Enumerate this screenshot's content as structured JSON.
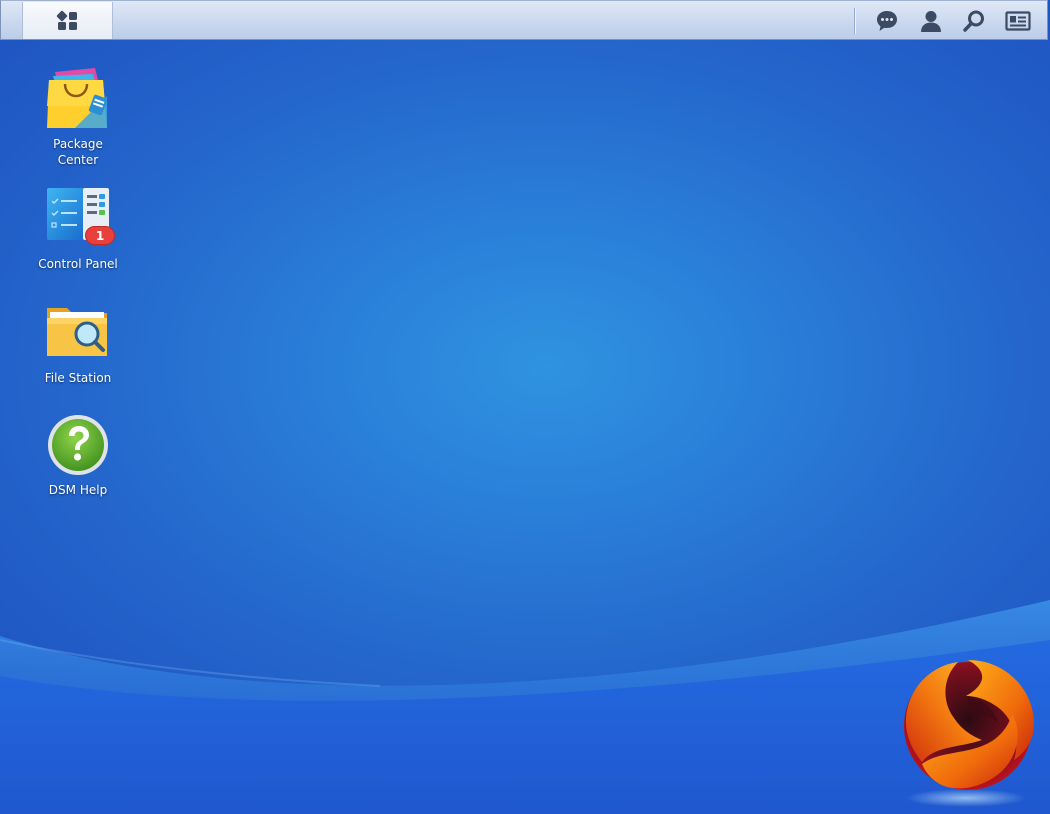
{
  "taskbar": {
    "main_menu_icon": "main-menu-grid-icon",
    "tray": [
      {
        "name": "notifications",
        "icon": "chat-bubble-icon"
      },
      {
        "name": "user-options",
        "icon": "user-icon"
      },
      {
        "name": "search",
        "icon": "search-icon"
      },
      {
        "name": "widgets",
        "icon": "id-card-icon"
      }
    ]
  },
  "desktop": {
    "shortcuts": [
      {
        "label": "Package\nCenter",
        "icon": "package-center-icon"
      },
      {
        "label": "Control Panel",
        "icon": "control-panel-icon",
        "badge": "1"
      },
      {
        "label": "File Station",
        "icon": "file-station-icon"
      },
      {
        "label": "DSM Help",
        "icon": "help-icon"
      }
    ]
  },
  "colors": {
    "desktop_blue": "#2a7fd8",
    "taskbar_bg": "#c9d7ee",
    "badge_red": "#e8403c"
  }
}
